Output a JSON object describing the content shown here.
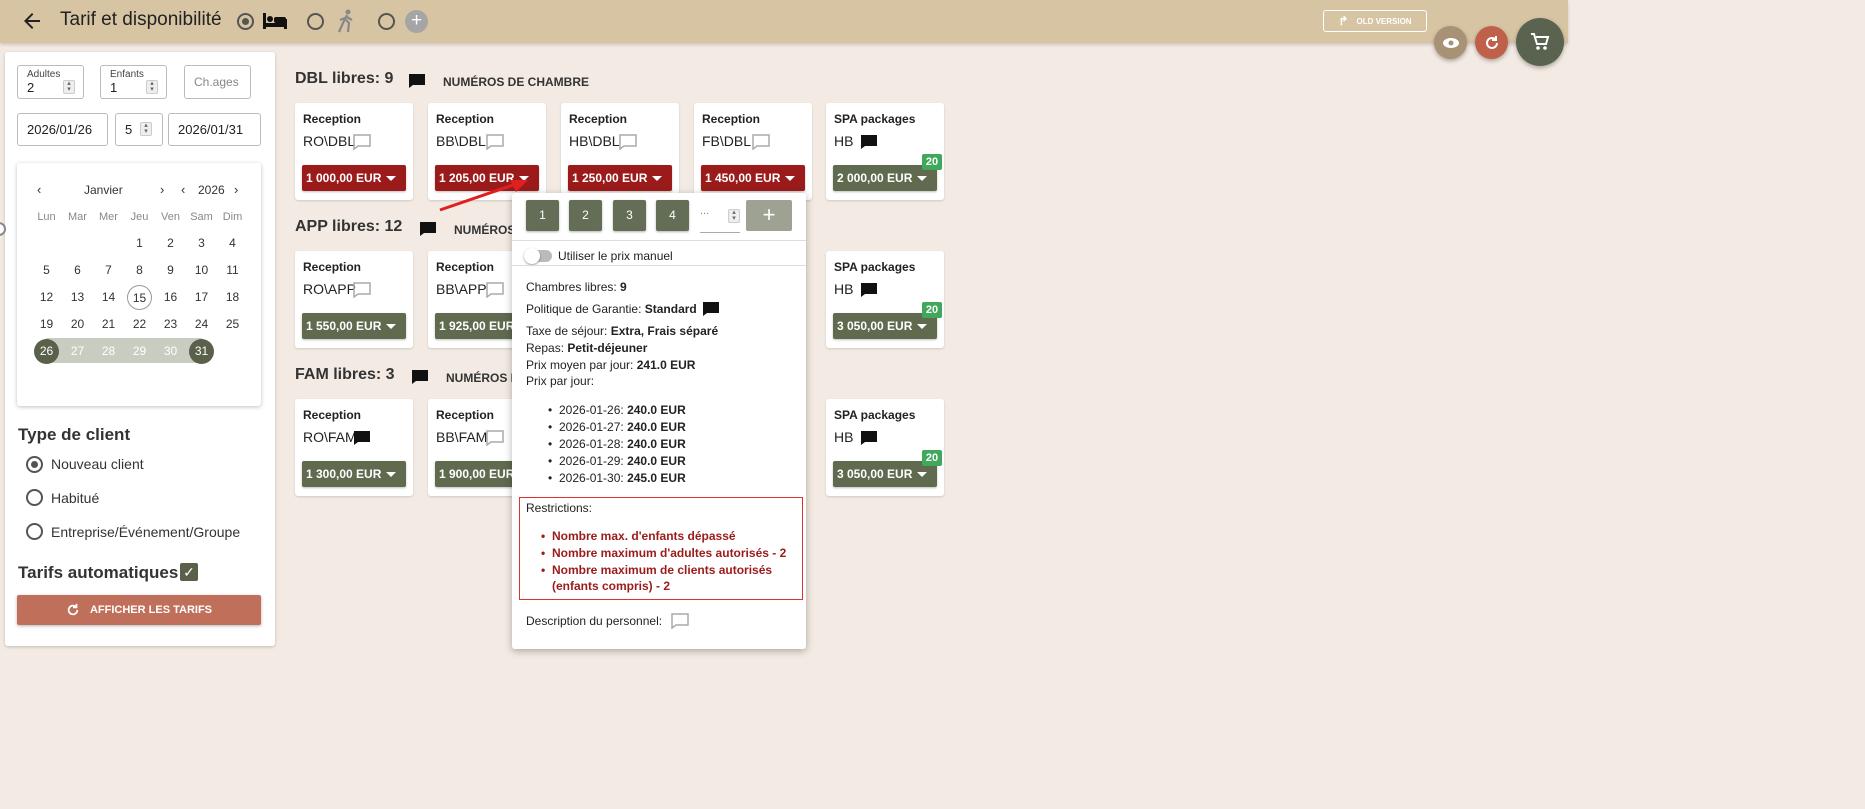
{
  "header": {
    "title": "Tarif et disponibilité",
    "old_version": "OLD VERSION"
  },
  "search": {
    "adults_label": "Adultes",
    "adults": "2",
    "children_label": "Enfants",
    "children": "1",
    "ages_placeholder": "Ch.ages",
    "date_from": "2026/01/26",
    "nights": "5",
    "date_to": "2026/01/31"
  },
  "calendar": {
    "month": "Janvier",
    "year": "2026",
    "dow": [
      "Lun",
      "Mar",
      "Mer",
      "Jeu",
      "Ven",
      "Sam",
      "Dim"
    ],
    "weeks": [
      [
        "",
        "",
        "",
        "1",
        "2",
        "3",
        "4"
      ],
      [
        "5",
        "6",
        "7",
        "8",
        "9",
        "10",
        "11"
      ],
      [
        "12",
        "13",
        "14",
        "15",
        "16",
        "17",
        "18"
      ],
      [
        "19",
        "20",
        "21",
        "22",
        "23",
        "24",
        "25"
      ],
      [
        "26",
        "27",
        "28",
        "29",
        "30",
        "31",
        ""
      ]
    ],
    "today": "15",
    "range_start": "26",
    "range_end": "31"
  },
  "client": {
    "title": "Type de client",
    "options": [
      "Nouveau client",
      "Habitué",
      "Entreprise/Événement/Groupe"
    ],
    "selected": 0
  },
  "auto_rates": "Tarifs automatiques",
  "show_button": "AFFICHER LES TARIFS",
  "sections": [
    {
      "title": "DBL libres: 9",
      "numbers": "NUMÉROS DE CHAMBRE",
      "cards": [
        {
          "title": "Reception",
          "sub": "RO\\DBL",
          "price": "1 000,00 EUR",
          "color": "red"
        },
        {
          "title": "Reception",
          "sub": "BB\\DBL",
          "price": "1 205,00 EUR",
          "color": "red"
        },
        {
          "title": "Reception",
          "sub": "HB\\DBL",
          "price": "1 250,00 EUR",
          "color": "red"
        },
        {
          "title": "Reception",
          "sub": "FB\\DBL",
          "price": "1 450,00 EUR",
          "color": "red"
        },
        {
          "title": "SPA packages",
          "sub": "HB",
          "price": "2 000,00 EUR",
          "color": "green",
          "badge": "20"
        }
      ]
    },
    {
      "title": "APP libres: 12",
      "numbers": "NUMÉROS",
      "cards": [
        {
          "title": "Reception",
          "sub": "RO\\APP",
          "price": "1 550,00 EUR",
          "color": "green"
        },
        {
          "title": "Reception",
          "sub": "BB\\APP",
          "price": "1 925,00 EUR",
          "color": "green"
        },
        {
          "title": "SPA packages",
          "sub": "HB",
          "price": "3 050,00 EUR",
          "color": "green",
          "badge": "20"
        }
      ]
    },
    {
      "title": "FAM libres: 3",
      "numbers": "NUMÉROS D",
      "cards": [
        {
          "title": "Reception",
          "sub": "RO\\FAM",
          "price": "1 300,00 EUR",
          "color": "green"
        },
        {
          "title": "Reception",
          "sub": "BB\\FAM",
          "price": "1 900,00 EUR",
          "color": "green"
        },
        {
          "title": "SPA packages",
          "sub": "HB",
          "price": "3 050,00 EUR",
          "color": "green",
          "badge": "20"
        }
      ]
    }
  ],
  "popup": {
    "qty": [
      "1",
      "2",
      "3",
      "4"
    ],
    "qty_placeholder": "...",
    "manual_price": "Utiliser le prix manuel",
    "free_rooms_label": "Chambres libres:",
    "free_rooms": "9",
    "guarantee_label": "Politique de Garantie:",
    "guarantee": "Standard",
    "tax_label": "Taxe de séjour:",
    "tax": "Extra, Frais séparé",
    "meal_label": "Repas:",
    "meal": "Petit-déjeuner",
    "avg_label": "Prix moyen par jour:",
    "avg": "241.0 EUR",
    "per_day_label": "Prix par jour:",
    "per_day": [
      {
        "date": "2026-01-26:",
        "price": "240.0 EUR"
      },
      {
        "date": "2026-01-27:",
        "price": "240.0 EUR"
      },
      {
        "date": "2026-01-28:",
        "price": "240.0 EUR"
      },
      {
        "date": "2026-01-29:",
        "price": "240.0 EUR"
      },
      {
        "date": "2026-01-30:",
        "price": "245.0 EUR"
      }
    ],
    "restrictions_label": "Restrictions:",
    "restrictions": [
      "Nombre max. d'enfants dépassé",
      "Nombre maximum d'adultes autorisés - 2",
      "Nombre maximum de clients autorisés (enfants compris) - 2"
    ],
    "staff_desc": "Description du personnel:"
  },
  "colors": {
    "header": "#d7c4a3",
    "accent_green": "#59614b",
    "price_red": "#9b1b1b",
    "badge_green": "#3fa85a",
    "refresh_btn": "#c0705a"
  }
}
